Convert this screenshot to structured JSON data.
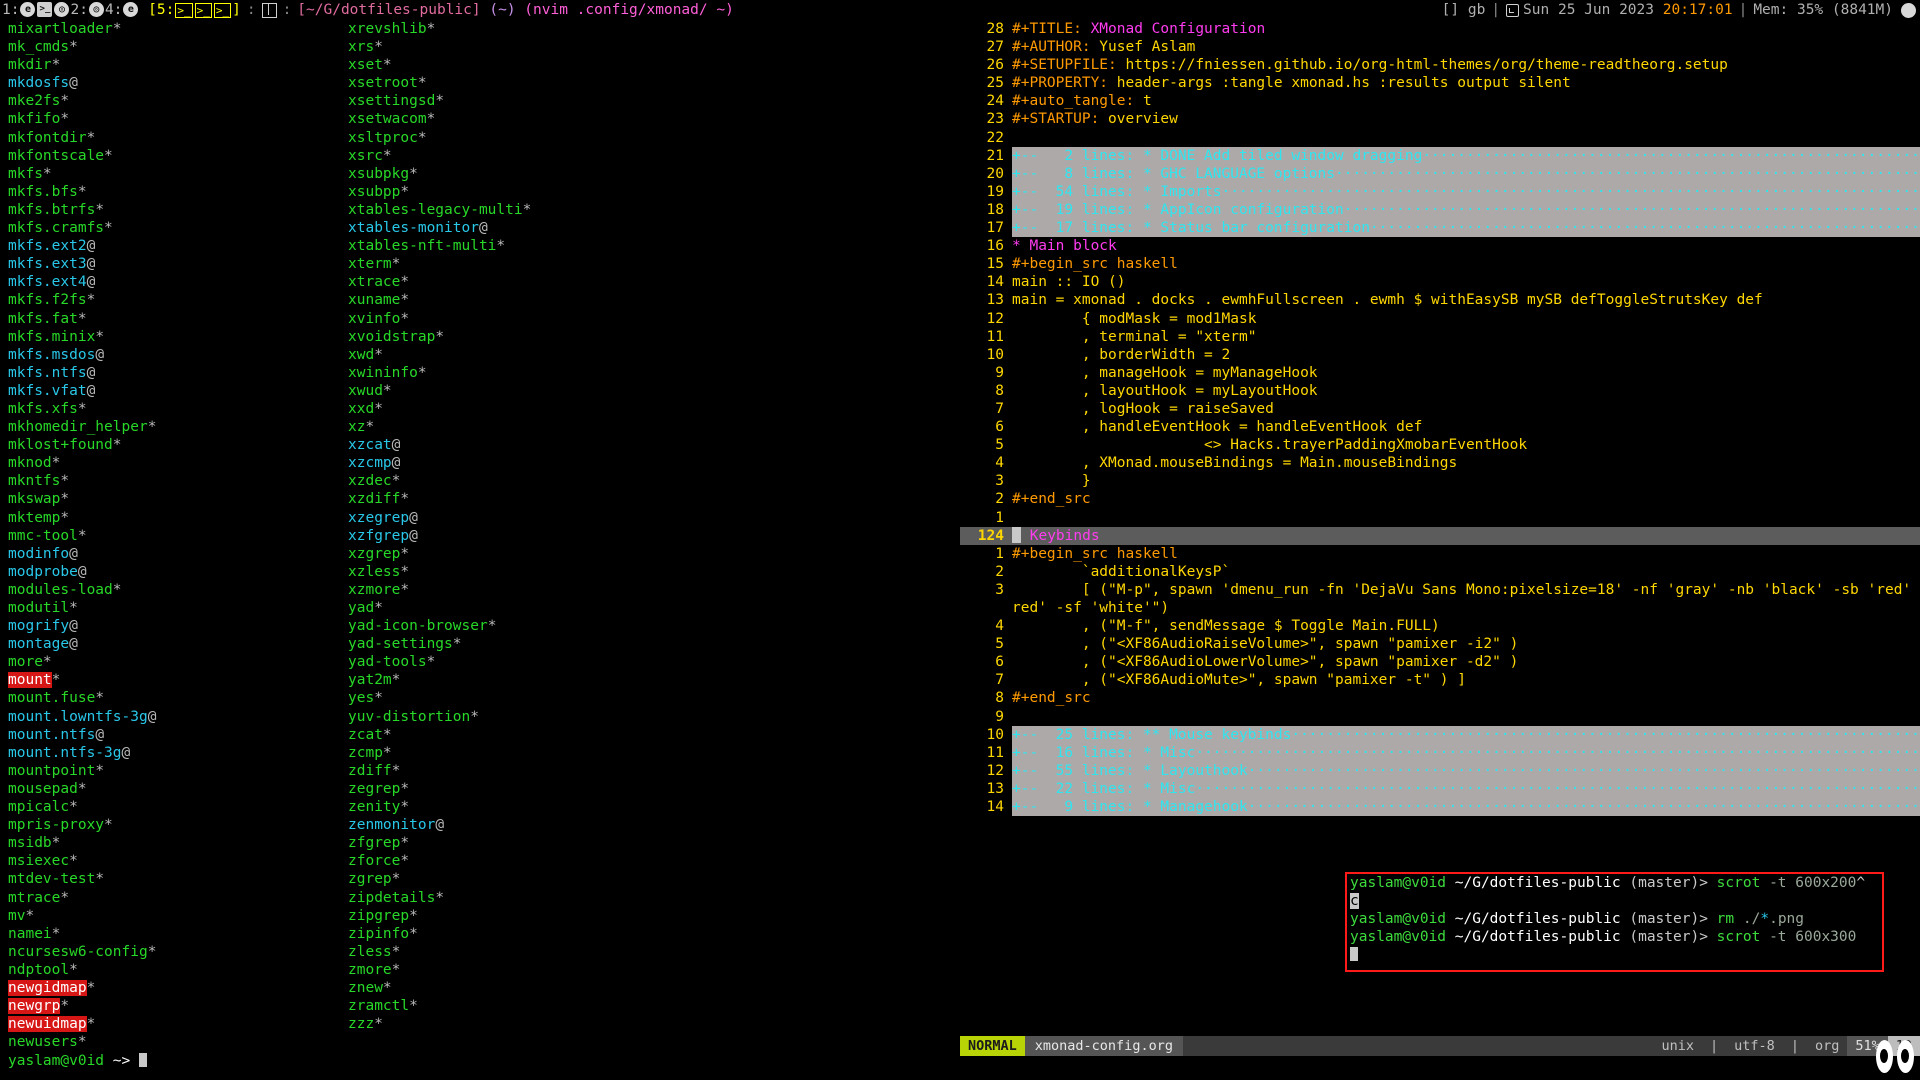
{
  "xmobar": {
    "workspaces": [
      {
        "num": "1:",
        "icons": [
          "firefox-icon",
          "terminal-icon",
          "chrome-icon"
        ],
        "active": false
      },
      {
        "num": "2:",
        "icons": [
          "chrome-icon"
        ],
        "active": false
      },
      {
        "num": "4:",
        "icons": [
          "firefox-icon"
        ],
        "active": false
      },
      {
        "num": "5:",
        "icons": [
          "terminal-icon",
          "terminal-icon",
          "terminal-icon"
        ],
        "active": true
      }
    ],
    "separator": ":",
    "layout_icon": "tall-layout-icon",
    "path": "[~/G/dotfiles-public]",
    "home": "(~)",
    "window_title": "(nvim .config/xmonad/ ~)",
    "keyboard": "[] gb",
    "bar_sep": "|",
    "date": "Sun 25 Jun 2023",
    "time": "20:17:01",
    "memory": "Mem: 35% (8841M)",
    "tray_icon": "trayer-icon"
  },
  "left_terminal": {
    "column1": [
      {
        "name": "mixartloader",
        "mark": "*",
        "type": "exec"
      },
      {
        "name": "mk_cmds",
        "mark": "*",
        "type": "exec"
      },
      {
        "name": "mkdir",
        "mark": "*",
        "type": "exec"
      },
      {
        "name": "mkdosfs",
        "mark": "@",
        "type": "link"
      },
      {
        "name": "mke2fs",
        "mark": "*",
        "type": "exec"
      },
      {
        "name": "mkfifo",
        "mark": "*",
        "type": "exec"
      },
      {
        "name": "mkfontdir",
        "mark": "*",
        "type": "exec"
      },
      {
        "name": "mkfontscale",
        "mark": "*",
        "type": "exec"
      },
      {
        "name": "mkfs",
        "mark": "*",
        "type": "exec"
      },
      {
        "name": "mkfs.bfs",
        "mark": "*",
        "type": "exec"
      },
      {
        "name": "mkfs.btrfs",
        "mark": "*",
        "type": "exec"
      },
      {
        "name": "mkfs.cramfs",
        "mark": "*",
        "type": "exec"
      },
      {
        "name": "mkfs.ext2",
        "mark": "@",
        "type": "link"
      },
      {
        "name": "mkfs.ext3",
        "mark": "@",
        "type": "link"
      },
      {
        "name": "mkfs.ext4",
        "mark": "@",
        "type": "link"
      },
      {
        "name": "mkfs.f2fs",
        "mark": "*",
        "type": "exec"
      },
      {
        "name": "mkfs.fat",
        "mark": "*",
        "type": "exec"
      },
      {
        "name": "mkfs.minix",
        "mark": "*",
        "type": "exec"
      },
      {
        "name": "mkfs.msdos",
        "mark": "@",
        "type": "link"
      },
      {
        "name": "mkfs.ntfs",
        "mark": "@",
        "type": "link"
      },
      {
        "name": "mkfs.vfat",
        "mark": "@",
        "type": "link"
      },
      {
        "name": "mkfs.xfs",
        "mark": "*",
        "type": "exec"
      },
      {
        "name": "mkhomedir_helper",
        "mark": "*",
        "type": "exec"
      },
      {
        "name": "mklost+found",
        "mark": "*",
        "type": "exec"
      },
      {
        "name": "mknod",
        "mark": "*",
        "type": "exec"
      },
      {
        "name": "mkntfs",
        "mark": "*",
        "type": "exec"
      },
      {
        "name": "mkswap",
        "mark": "*",
        "type": "exec"
      },
      {
        "name": "mktemp",
        "mark": "*",
        "type": "exec"
      },
      {
        "name": "mmc-tool",
        "mark": "*",
        "type": "exec"
      },
      {
        "name": "modinfo",
        "mark": "@",
        "type": "link"
      },
      {
        "name": "modprobe",
        "mark": "@",
        "type": "link"
      },
      {
        "name": "modules-load",
        "mark": "*",
        "type": "exec"
      },
      {
        "name": "modutil",
        "mark": "*",
        "type": "exec"
      },
      {
        "name": "mogrify",
        "mark": "@",
        "type": "link"
      },
      {
        "name": "montage",
        "mark": "@",
        "type": "link"
      },
      {
        "name": "more",
        "mark": "*",
        "type": "exec"
      },
      {
        "name": "mount",
        "mark": "*",
        "type": "setuid"
      },
      {
        "name": "mount.fuse",
        "mark": "*",
        "type": "exec"
      },
      {
        "name": "mount.lowntfs-3g",
        "mark": "@",
        "type": "link"
      },
      {
        "name": "mount.ntfs",
        "mark": "@",
        "type": "link"
      },
      {
        "name": "mount.ntfs-3g",
        "mark": "@",
        "type": "link"
      },
      {
        "name": "mountpoint",
        "mark": "*",
        "type": "exec"
      },
      {
        "name": "mousepad",
        "mark": "*",
        "type": "exec"
      },
      {
        "name": "mpicalc",
        "mark": "*",
        "type": "exec"
      },
      {
        "name": "mpris-proxy",
        "mark": "*",
        "type": "exec"
      },
      {
        "name": "msidb",
        "mark": "*",
        "type": "exec"
      },
      {
        "name": "msiexec",
        "mark": "*",
        "type": "exec"
      },
      {
        "name": "mtdev-test",
        "mark": "*",
        "type": "exec"
      },
      {
        "name": "mtrace",
        "mark": "*",
        "type": "exec"
      },
      {
        "name": "mv",
        "mark": "*",
        "type": "exec"
      },
      {
        "name": "namei",
        "mark": "*",
        "type": "exec"
      },
      {
        "name": "ncursesw6-config",
        "mark": "*",
        "type": "exec"
      },
      {
        "name": "ndptool",
        "mark": "*",
        "type": "exec"
      },
      {
        "name": "newgidmap",
        "mark": "*",
        "type": "setuid"
      },
      {
        "name": "newgrp",
        "mark": "*",
        "type": "setuid"
      },
      {
        "name": "newuidmap",
        "mark": "*",
        "type": "setuid"
      },
      {
        "name": "newusers",
        "mark": "*",
        "type": "exec"
      }
    ],
    "column2": [
      {
        "name": "xrevshlib",
        "mark": "*",
        "type": "exec"
      },
      {
        "name": "xrs",
        "mark": "*",
        "type": "exec"
      },
      {
        "name": "xset",
        "mark": "*",
        "type": "exec"
      },
      {
        "name": "xsetroot",
        "mark": "*",
        "type": "exec"
      },
      {
        "name": "xsettingsd",
        "mark": "*",
        "type": "exec"
      },
      {
        "name": "xsetwacom",
        "mark": "*",
        "type": "exec"
      },
      {
        "name": "xsltproc",
        "mark": "*",
        "type": "exec"
      },
      {
        "name": "xsrc",
        "mark": "*",
        "type": "exec"
      },
      {
        "name": "xsubpkg",
        "mark": "*",
        "type": "exec"
      },
      {
        "name": "xsubpp",
        "mark": "*",
        "type": "exec"
      },
      {
        "name": "xtables-legacy-multi",
        "mark": "*",
        "type": "exec"
      },
      {
        "name": "xtables-monitor",
        "mark": "@",
        "type": "link"
      },
      {
        "name": "xtables-nft-multi",
        "mark": "*",
        "type": "exec"
      },
      {
        "name": "xterm",
        "mark": "*",
        "type": "exec"
      },
      {
        "name": "xtrace",
        "mark": "*",
        "type": "exec"
      },
      {
        "name": "xuname",
        "mark": "*",
        "type": "exec"
      },
      {
        "name": "xvinfo",
        "mark": "*",
        "type": "exec"
      },
      {
        "name": "xvoidstrap",
        "mark": "*",
        "type": "exec"
      },
      {
        "name": "xwd",
        "mark": "*",
        "type": "exec"
      },
      {
        "name": "xwininfo",
        "mark": "*",
        "type": "exec"
      },
      {
        "name": "xwud",
        "mark": "*",
        "type": "exec"
      },
      {
        "name": "xxd",
        "mark": "*",
        "type": "exec"
      },
      {
        "name": "xz",
        "mark": "*",
        "type": "exec"
      },
      {
        "name": "xzcat",
        "mark": "@",
        "type": "link"
      },
      {
        "name": "xzcmp",
        "mark": "@",
        "type": "link"
      },
      {
        "name": "xzdec",
        "mark": "*",
        "type": "exec"
      },
      {
        "name": "xzdiff",
        "mark": "*",
        "type": "exec"
      },
      {
        "name": "xzegrep",
        "mark": "@",
        "type": "link"
      },
      {
        "name": "xzfgrep",
        "mark": "@",
        "type": "link"
      },
      {
        "name": "xzgrep",
        "mark": "*",
        "type": "exec"
      },
      {
        "name": "xzless",
        "mark": "*",
        "type": "exec"
      },
      {
        "name": "xzmore",
        "mark": "*",
        "type": "exec"
      },
      {
        "name": "yad",
        "mark": "*",
        "type": "exec"
      },
      {
        "name": "yad-icon-browser",
        "mark": "*",
        "type": "exec"
      },
      {
        "name": "yad-settings",
        "mark": "*",
        "type": "exec"
      },
      {
        "name": "yad-tools",
        "mark": "*",
        "type": "exec"
      },
      {
        "name": "yat2m",
        "mark": "*",
        "type": "exec"
      },
      {
        "name": "yes",
        "mark": "*",
        "type": "exec"
      },
      {
        "name": "yuv-distortion",
        "mark": "*",
        "type": "exec"
      },
      {
        "name": "zcat",
        "mark": "*",
        "type": "exec"
      },
      {
        "name": "zcmp",
        "mark": "*",
        "type": "exec"
      },
      {
        "name": "zdiff",
        "mark": "*",
        "type": "exec"
      },
      {
        "name": "zegrep",
        "mark": "*",
        "type": "exec"
      },
      {
        "name": "zenity",
        "mark": "*",
        "type": "exec"
      },
      {
        "name": "zenmonitor",
        "mark": "@",
        "type": "link"
      },
      {
        "name": "zfgrep",
        "mark": "*",
        "type": "exec"
      },
      {
        "name": "zforce",
        "mark": "*",
        "type": "exec"
      },
      {
        "name": "zgrep",
        "mark": "*",
        "type": "exec"
      },
      {
        "name": "zipdetails",
        "mark": "*",
        "type": "exec"
      },
      {
        "name": "zipgrep",
        "mark": "*",
        "type": "exec"
      },
      {
        "name": "zipinfo",
        "mark": "*",
        "type": "exec"
      },
      {
        "name": "zless",
        "mark": "*",
        "type": "exec"
      },
      {
        "name": "zmore",
        "mark": "*",
        "type": "exec"
      },
      {
        "name": "znew",
        "mark": "*",
        "type": "exec"
      },
      {
        "name": "zramctl",
        "mark": "*",
        "type": "exec"
      },
      {
        "name": "zzz",
        "mark": "*",
        "type": "exec"
      }
    ],
    "prompt": {
      "user": "yaslam@v0id",
      "path": "~>"
    }
  },
  "nvim": {
    "lines": [
      {
        "n": "28",
        "kind": "kv",
        "key": "#+TITLE:",
        "val": " XMonad Configuration",
        "valclass": "kw-title"
      },
      {
        "n": "27",
        "kind": "kv",
        "key": "#+AUTHOR:",
        "val": " Yusef Aslam",
        "valclass": "kw-val"
      },
      {
        "n": "26",
        "kind": "kv",
        "key": "#+SETUPFILE:",
        "val": " https://fniessen.github.io/org-html-themes/org/theme-readtheorg.setup",
        "valclass": "kw-val"
      },
      {
        "n": "25",
        "kind": "kv",
        "key": "#+PROPERTY:",
        "val": " header-args :tangle xmonad.hs :results output silent",
        "valclass": "kw-val"
      },
      {
        "n": "24",
        "kind": "kv",
        "key": "#+auto_tangle:",
        "val": " t",
        "valclass": "kw-val"
      },
      {
        "n": "23",
        "kind": "kv",
        "key": "#+STARTUP:",
        "val": " overview",
        "valclass": "kw-val"
      },
      {
        "n": "22",
        "kind": "blank",
        "text": ""
      },
      {
        "n": "21",
        "kind": "fold",
        "text": "+--   2 lines: * DONE Add tiled window dragging"
      },
      {
        "n": "20",
        "kind": "fold",
        "text": "+--   8 lines: * GHC LANGUAGE options"
      },
      {
        "n": "19",
        "kind": "fold",
        "text": "+--  54 lines: * Imports"
      },
      {
        "n": "18",
        "kind": "fold",
        "text": "+--  19 lines: * AppIcon configuration"
      },
      {
        "n": "17",
        "kind": "fold",
        "text": "+--  17 lines: * Status bar configuration"
      },
      {
        "n": "16",
        "kind": "head",
        "text": "* Main block"
      },
      {
        "n": "15",
        "kind": "src",
        "text": "#+begin_src haskell"
      },
      {
        "n": "14",
        "kind": "code",
        "text": "main :: IO ()"
      },
      {
        "n": "13",
        "kind": "code",
        "text": "main = xmonad . docks . ewmhFullscreen . ewmh $ withEasySB mySB defToggleStrutsKey def"
      },
      {
        "n": "12",
        "kind": "code",
        "text": "        { modMask = mod1Mask"
      },
      {
        "n": "11",
        "kind": "code",
        "text": "        , terminal = \"xterm\""
      },
      {
        "n": "10",
        "kind": "code",
        "text": "        , borderWidth = 2"
      },
      {
        "n": "9",
        "kind": "code",
        "text": "        , manageHook = myManageHook"
      },
      {
        "n": "8",
        "kind": "code",
        "text": "        , layoutHook = myLayoutHook"
      },
      {
        "n": "7",
        "kind": "code",
        "text": "        , logHook = raiseSaved"
      },
      {
        "n": "6",
        "kind": "code",
        "text": "        , handleEventHook = handleEventHook def"
      },
      {
        "n": "5",
        "kind": "code",
        "text": "                      <> Hacks.trayerPaddingXmobarEventHook"
      },
      {
        "n": "4",
        "kind": "code",
        "text": "        , XMonad.mouseBindings = Main.mouseBindings"
      },
      {
        "n": "3",
        "kind": "code",
        "text": "        }"
      },
      {
        "n": "2",
        "kind": "src",
        "text": "#+end_src"
      },
      {
        "n": "1",
        "kind": "blank",
        "text": ""
      },
      {
        "n": "124",
        "kind": "cursor",
        "text": "* Keybinds"
      },
      {
        "n": "1",
        "kind": "src",
        "text": "#+begin_src haskell"
      },
      {
        "n": "2",
        "kind": "code",
        "text": "        `additionalKeysP`"
      },
      {
        "n": "3",
        "kind": "code",
        "text": "        [ (\"M-p\", spawn 'dmenu_run -fn 'DejaVu Sans Mono:pixelsize=18' -nf 'gray' -nb 'black' -sb 'red' -sf 'white'\")"
      },
      {
        "n": "4",
        "kind": "code",
        "text": "        , (\"M-f\", sendMessage $ Toggle Main.FULL)"
      },
      {
        "n": "5",
        "kind": "code",
        "text": "        , (\"<XF86AudioRaiseVolume>\", spawn \"pamixer -i2\" )"
      },
      {
        "n": "6",
        "kind": "code",
        "text": "        , (\"<XF86AudioLowerVolume>\", spawn \"pamixer -d2\" )"
      },
      {
        "n": "7",
        "kind": "code",
        "text": "        , (\"<XF86AudioMute>\", spawn \"pamixer -t\" ) ]"
      },
      {
        "n": "8",
        "kind": "src",
        "text": "#+end_src"
      },
      {
        "n": "9",
        "kind": "blank",
        "text": ""
      },
      {
        "n": "10",
        "kind": "fold",
        "text": "+--  25 lines: ** Mouse keybinds"
      },
      {
        "n": "11",
        "kind": "fold",
        "text": "+--  16 lines: * Misc"
      },
      {
        "n": "12",
        "kind": "fold",
        "text": "+--  55 lines: * Layouthook"
      },
      {
        "n": "13",
        "kind": "fold",
        "text": "+--  22 lines: * Misc"
      },
      {
        "n": "14",
        "kind": "fold",
        "text": "+--   9 lines: * Managehook"
      }
    ],
    "wrap_line3": "red' -sf 'white'\")",
    "statusline": {
      "mode": "NORMAL",
      "filename": "xmonad-config.org",
      "fileformat": "unix",
      "encoding": "utf-8",
      "filetype": "org",
      "percent": "51%",
      "position": "12"
    }
  },
  "float_terminal": {
    "border_color": "#ff1a1a",
    "lines": [
      {
        "user": "yaslam@v0id",
        "path": " ~/G/dotfiles-public",
        "branch": " (master)>",
        "cmd": " scrot",
        "arg": " -t 600x200",
        "wrapchar": "^"
      },
      {
        "wrap": "c"
      },
      {
        "user": "yaslam@v0id",
        "path": " ~/G/dotfiles-public",
        "branch": " (master)>",
        "cmd": " rm",
        "arg": " ./",
        "glob": "*",
        "argtail": ".png"
      },
      {
        "user": "yaslam@v0id",
        "path": " ~/G/dotfiles-public",
        "branch": " (master)>",
        "cmd": " scrot",
        "arg": " -t 600x300"
      }
    ]
  }
}
